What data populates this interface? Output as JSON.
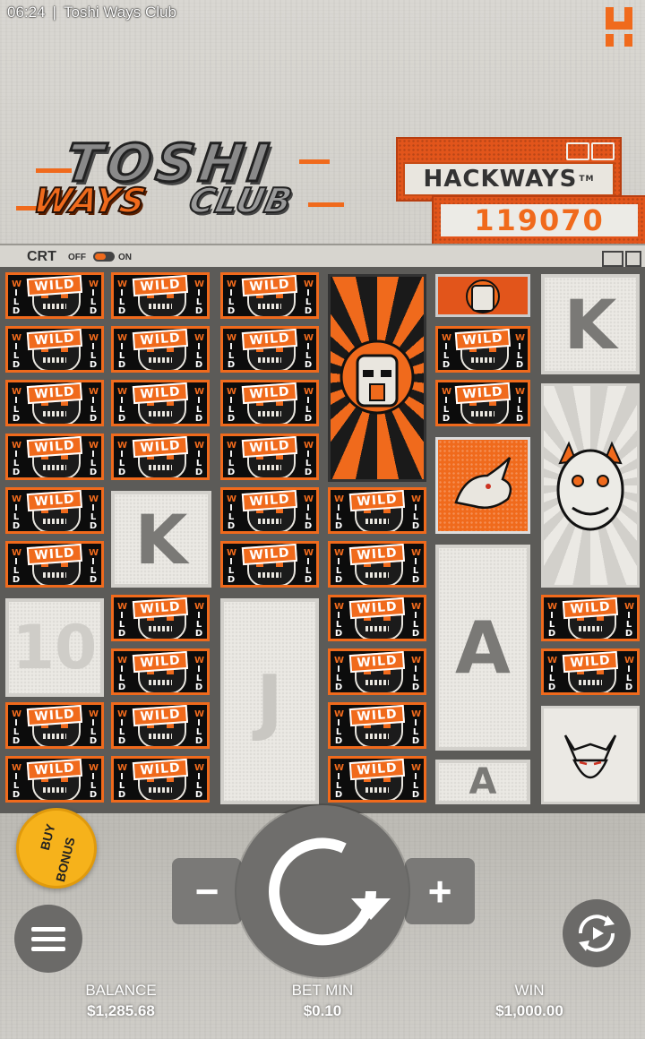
{
  "status_bar": {
    "time": "06:24",
    "app_title": "Toshi Ways Club"
  },
  "logo": {
    "title_line1": "TOSHI",
    "title_line2a": "WAYS",
    "title_line2b": "CLUB"
  },
  "hackways": {
    "label": "HACKWAYS",
    "tm": "TM",
    "count": "119070"
  },
  "crt": {
    "label": "CRT",
    "off": "OFF",
    "on": "ON"
  },
  "wild_text": "WILD",
  "wild_side": [
    "W",
    "I",
    "L",
    "D"
  ],
  "letters": {
    "k1": "K",
    "k2": "K",
    "ten": "10",
    "j": "J",
    "a1": "A",
    "a2": "A"
  },
  "buy_bonus": {
    "line1": "BUY",
    "line2": "BONUS"
  },
  "controls": {
    "minus": "−",
    "plus": "+"
  },
  "footer": {
    "balance_label": "BALANCE",
    "balance_value": "$1,285.68",
    "bet_label": "BET MIN",
    "bet_value": "$0.10",
    "win_label": "WIN",
    "win_value": "$1,000.00"
  },
  "colors": {
    "accent": "#f06a1c",
    "gold": "#f6b21b",
    "panel": "#ebe9e4"
  }
}
